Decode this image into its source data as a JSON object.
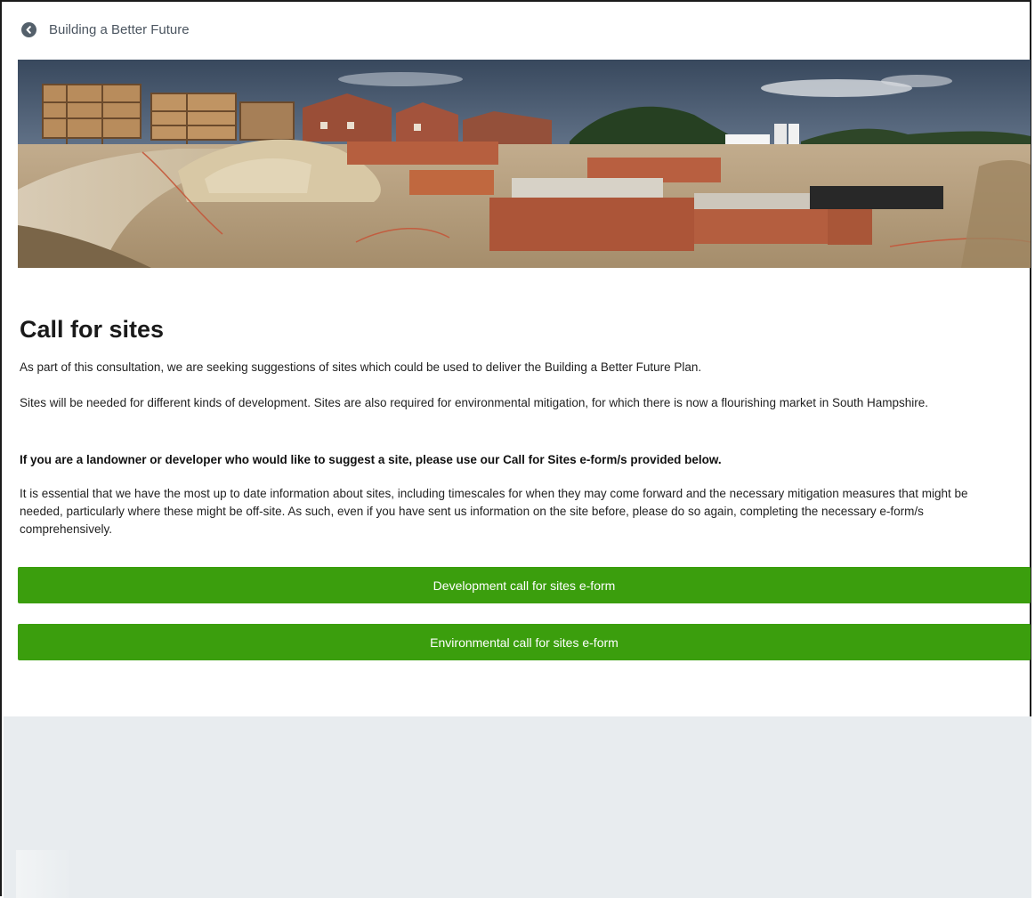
{
  "nav": {
    "back_label": "Building a Better Future",
    "back_icon": "arrow-left-circle-icon"
  },
  "banner": {
    "image_name": "housing-construction-site-photo"
  },
  "main": {
    "title": "Call for sites",
    "paragraphs": [
      "As part of this consultation, we are seeking suggestions of sites which could be used to deliver the Building a Better Future Plan.",
      "Sites will be needed for different kinds of development. Sites are also required for environmental mitigation, for which there is now a flourishing market in South Hampshire.",
      "If you are a landowner or developer who would like to suggest a site, please use our Call for Sites e-form/s provided below.",
      "It is essential that we have the most up to date information about sites, including timescales for when they may come forward and the necessary mitigation measures that might be needed, particularly where these might be off-site. As such, even if you have sent us information on the site before, please do so again, completing the necessary e-form/s comprehensively."
    ],
    "buttons": {
      "development": "Development call for sites e-form",
      "environmental": "Environmental call for sites e-form"
    }
  },
  "colors": {
    "button_green": "#3b9e0d",
    "footer_gray": "#e8ecef",
    "back_icon_gray": "#54606b"
  }
}
